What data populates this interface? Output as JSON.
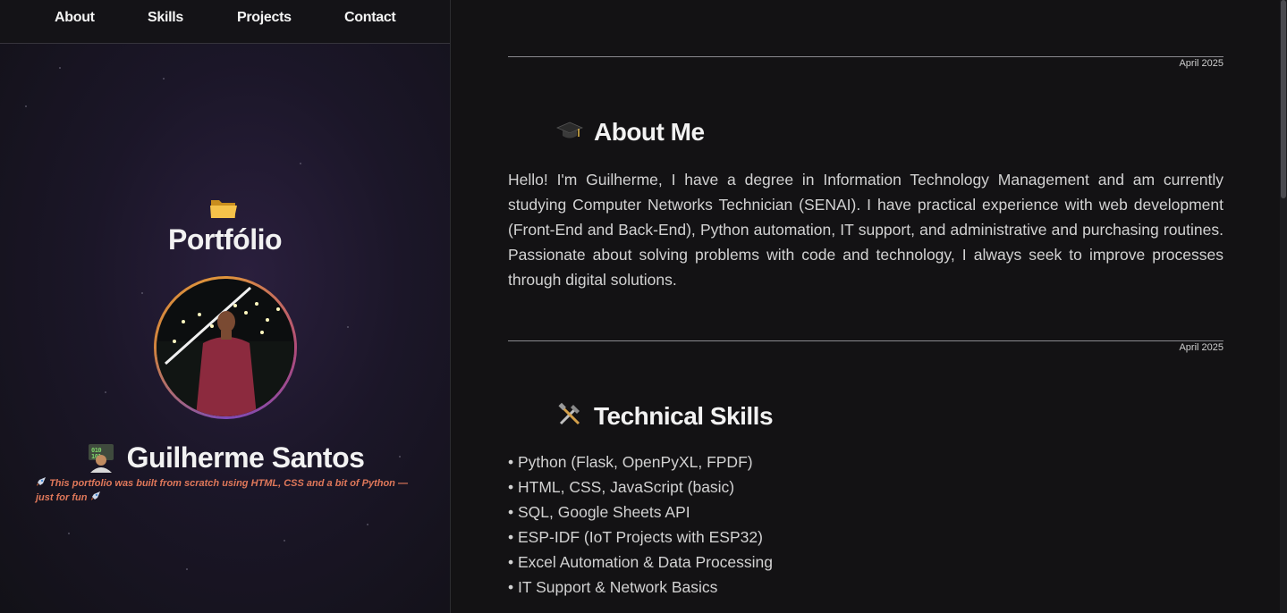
{
  "nav": {
    "items": [
      {
        "label": "About"
      },
      {
        "label": "Skills"
      },
      {
        "label": "Projects"
      },
      {
        "label": "Contact"
      }
    ]
  },
  "sidebar": {
    "title": "Portfólio",
    "name": "Guilherme Santos",
    "tagline": "This portfolio was built from scratch using HTML, CSS and a bit of Python — just for fun",
    "icons": {
      "title_icon": "folder-icon",
      "name_icon": "coder-icon",
      "tagline_icon": "rocket-icon"
    }
  },
  "sections": [
    {
      "date": "April 2025",
      "title": "About Me",
      "icon": "graduation-cap-icon",
      "text": "Hello! I'm Guilherme, I have a degree in Information Technology Management and am currently studying Computer Networks Technician (SENAI). I have practical experience with web development (Front-End and Back-End), Python automation, IT support, and administrative and purchasing routines. Passionate about solving problems with code and technology, I always seek to improve processes through digital solutions."
    },
    {
      "date": "April 2025",
      "title": "Technical Skills",
      "icon": "tools-icon",
      "items": [
        "Python (Flask, OpenPyXL, FPDF)",
        "HTML, CSS, JavaScript (basic)",
        "SQL, Google Sheets API",
        "ESP-IDF (IoT Projects with ESP32)",
        "Excel Automation & Data Processing",
        "IT Support & Network Basics"
      ]
    }
  ],
  "colors": {
    "accent_tagline": "#e0785a",
    "background": "#131214"
  }
}
